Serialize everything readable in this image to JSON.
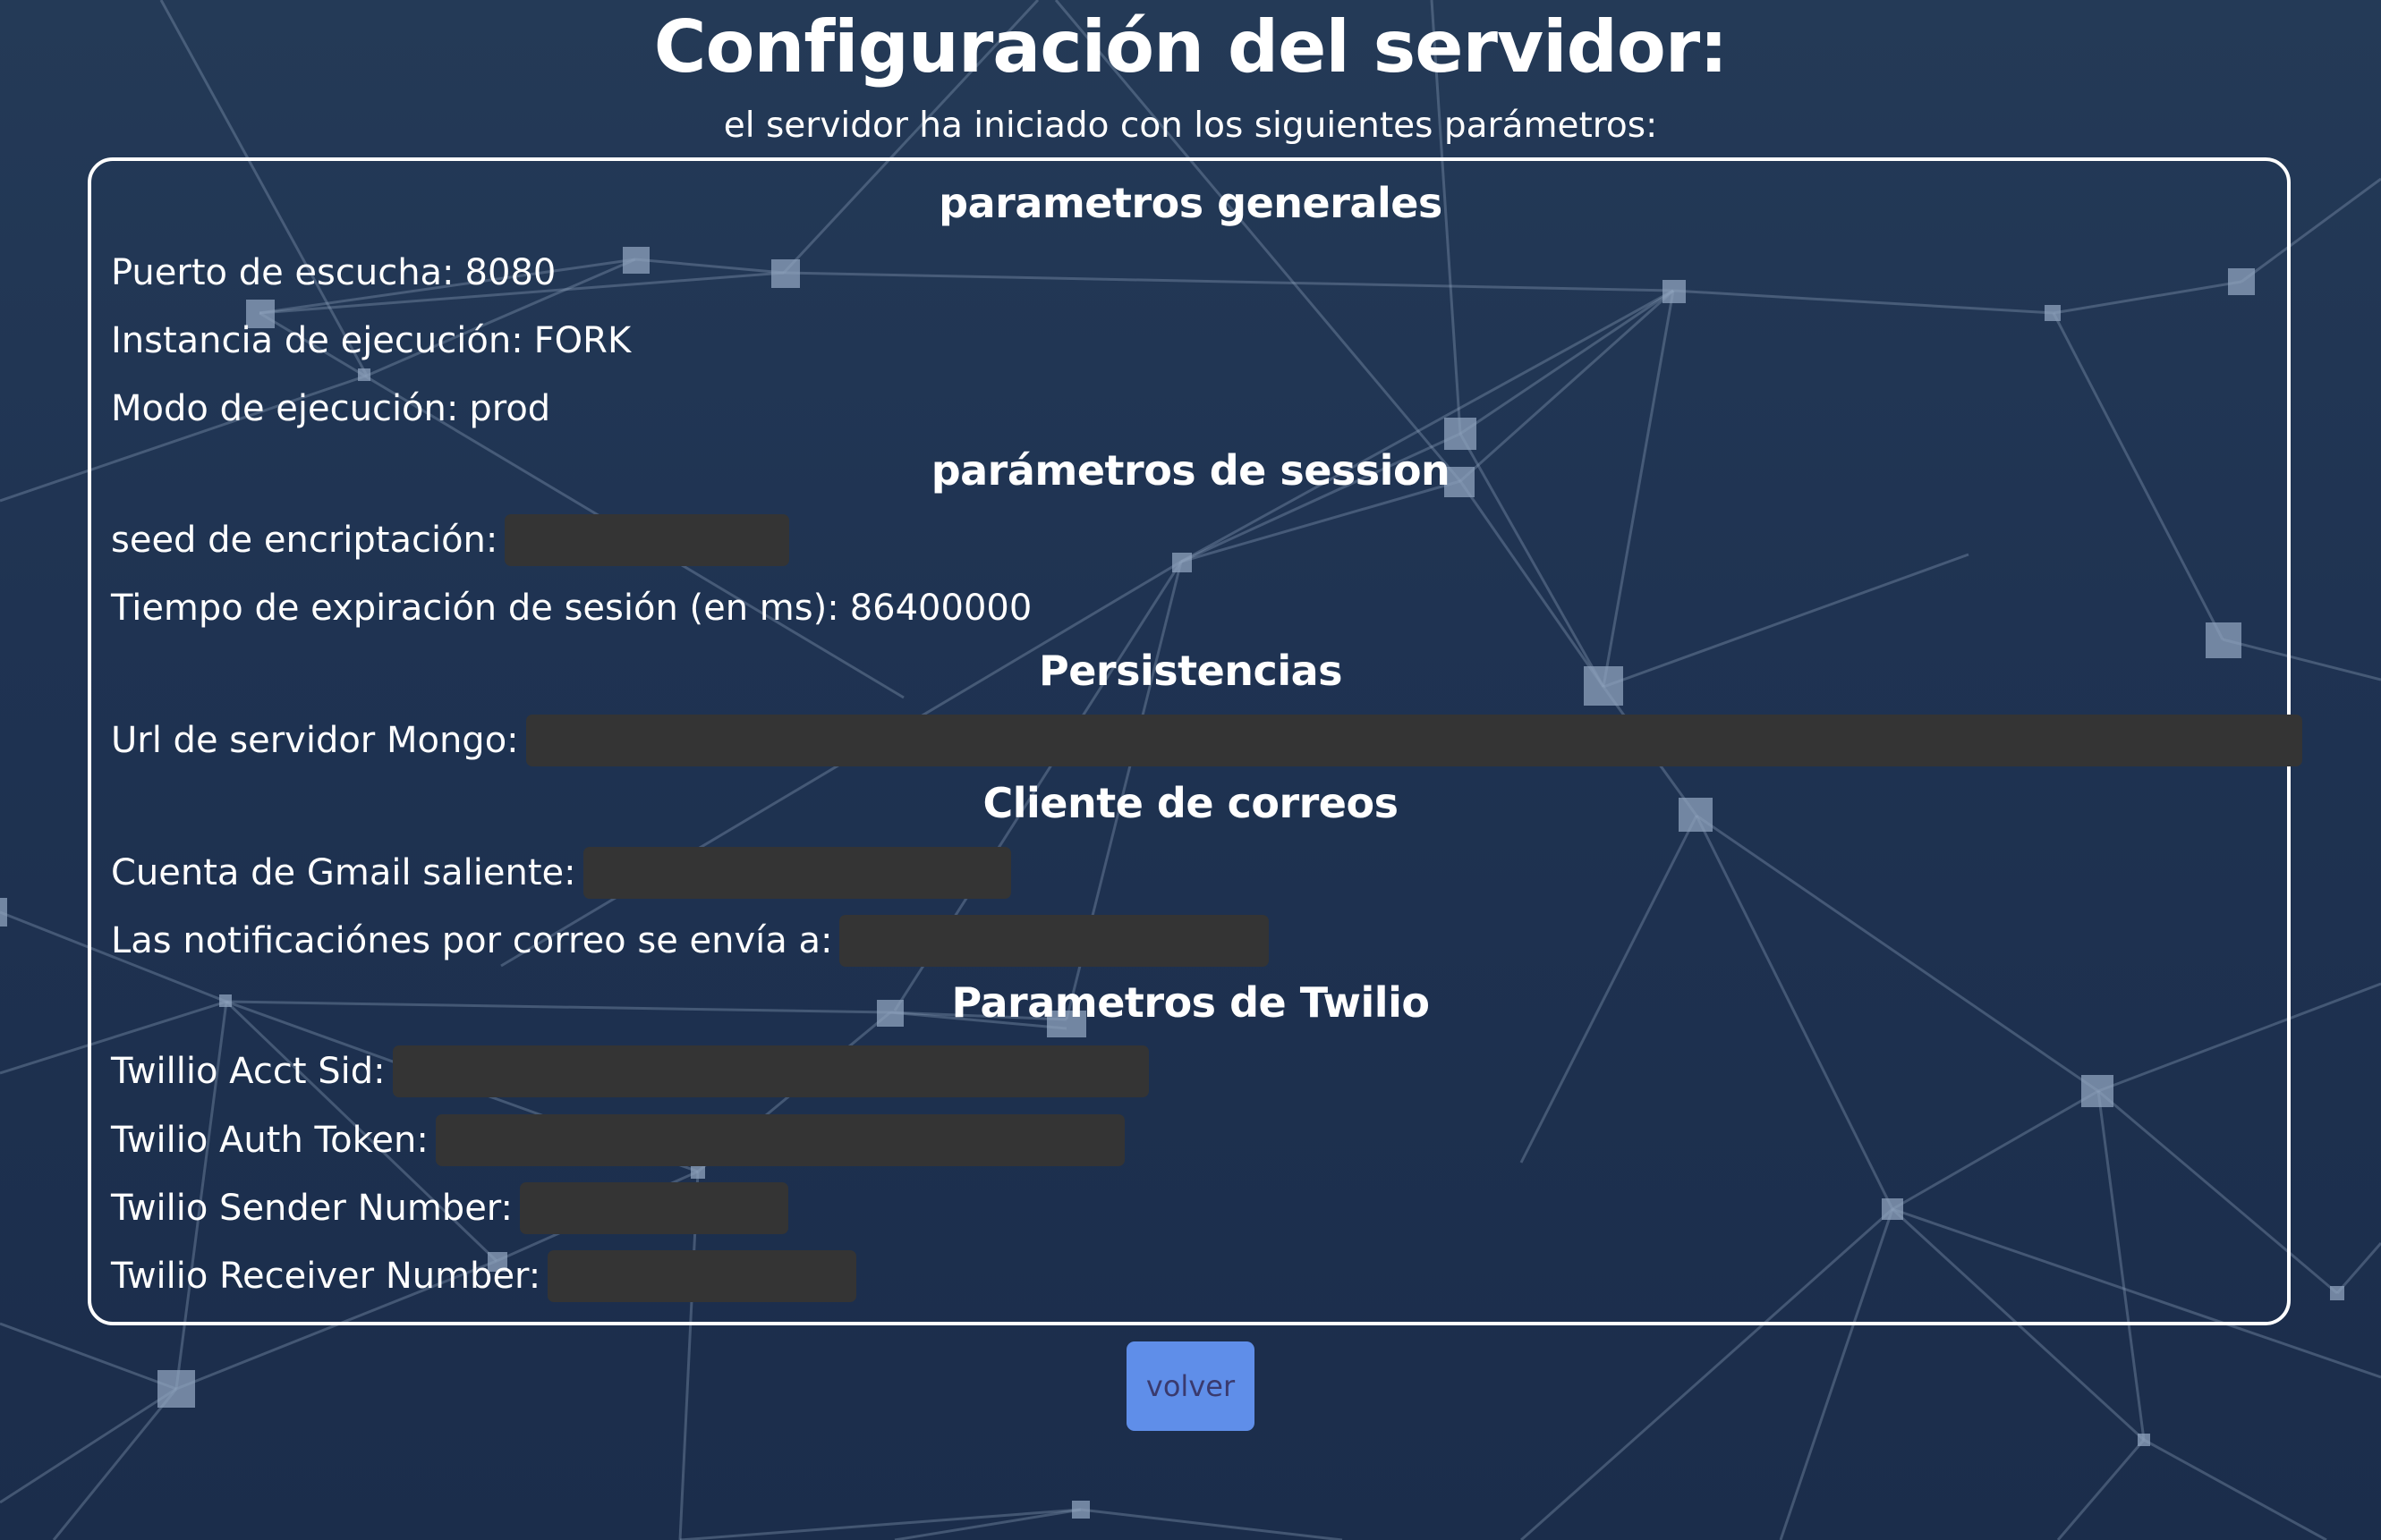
{
  "page": {
    "title": "Configuración del servidor:",
    "subtitle": "el servidor ha iniciado con los siguientes parámetros:"
  },
  "sections": {
    "general": {
      "heading": "parametros generales",
      "port_label": "Puerto de escucha:",
      "port_value": "8080",
      "instance_label": "Instancia de ejecución:",
      "instance_value": "FORK",
      "mode_label": "Modo de ejecución:",
      "mode_value": "prod"
    },
    "session": {
      "heading": "parámetros de session",
      "seed_label": "seed de encriptación:",
      "expiration_label": "Tiempo de expiración de sesión (en ms):",
      "expiration_value": "86400000"
    },
    "persistence": {
      "heading": "Persistencias",
      "mongo_label": "Url de servidor Mongo:"
    },
    "mail": {
      "heading": "Cliente de correos",
      "gmail_label": "Cuenta de Gmail saliente:",
      "notify_label": "Las notificaciónes por correo se envía a:"
    },
    "twilio": {
      "heading": "Parametros de Twilio",
      "sid_label": "Twillio Acct Sid:",
      "token_label": "Twilio Auth Token:",
      "sender_label": "Twilio Sender Number:",
      "receiver_label": "Twilio Receiver Number:"
    }
  },
  "actions": {
    "back_label": "volver"
  },
  "colors": {
    "background": "#1f3352",
    "text": "#ffffff",
    "redacted": "#343434",
    "button": "#5f8ee9",
    "button_text": "#3a3a6e",
    "network": "#8fa3bd"
  }
}
